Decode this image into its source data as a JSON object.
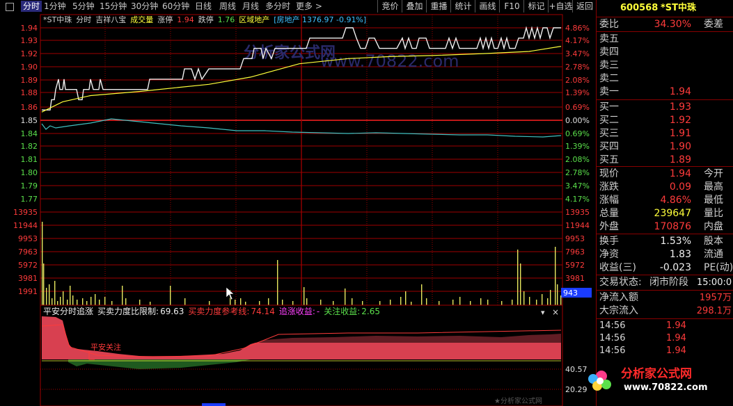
{
  "toolbar": {
    "tabs": [
      "分时",
      "1分钟",
      "5分钟",
      "15分钟",
      "30分钟",
      "60分钟",
      "日线",
      "周线",
      "月线",
      "多分时",
      "更多 >"
    ],
    "buttons": [
      "竞价",
      "叠加",
      "重播",
      "统计",
      "画线",
      "F10",
      "标记",
      "+自选",
      "返回"
    ]
  },
  "header": {
    "code": "*ST中珠",
    "mode": "分时",
    "indicator": "吉祥八宝",
    "vol_label": "成交量",
    "up_stop_label": "涨停",
    "up_stop": "1.94",
    "down_stop_label": "跌停",
    "down_stop": "1.76",
    "sector_label": "区域地产",
    "sector_detail": "[房地产 1376.97 -0.91%]"
  },
  "price_axis": [
    "1.94",
    "1.93",
    "1.92",
    "1.90",
    "1.89",
    "1.88",
    "1.86",
    "1.85",
    "1.84",
    "1.82",
    "1.81",
    "1.80",
    "1.79",
    "1.77"
  ],
  "pct_axis": [
    "4.86%",
    "4.17%",
    "3.47%",
    "2.78%",
    "2.08%",
    "1.39%",
    "0.69%",
    "0.00%",
    "0.69%",
    "1.39%",
    "2.08%",
    "2.78%",
    "3.47%",
    "4.17%"
  ],
  "vol_axis": [
    "13935",
    "11944",
    "9953",
    "7963",
    "5972",
    "3981",
    "1991"
  ],
  "vol_badge": "943",
  "indicator_bar": {
    "name": "平安分时追涨",
    "limit_label": "买卖力度比限制:",
    "limit_value": "69.63",
    "ref_label": "买卖力度参考线:",
    "ref_value": "74.14",
    "chase_label": "追涨收益:",
    "chase_value": "-",
    "focus_label": "关注收益:",
    "focus_value": "2.65",
    "signal_text": "平安关注",
    "axis": [
      "40.57",
      "20.29"
    ],
    "watermark": "★分析家公式网"
  },
  "chart_watermark": {
    "line1": "分析家公式网",
    "line2": "www.70822.com"
  },
  "panel": {
    "stock_code": "600568",
    "stock_name": "*ST中珠",
    "weibi_label": "委比",
    "weibi_value": "34.30%",
    "weicha_label": "委差",
    "sells": [
      {
        "label": "卖五",
        "price": ""
      },
      {
        "label": "卖四",
        "price": ""
      },
      {
        "label": "卖三",
        "price": ""
      },
      {
        "label": "卖二",
        "price": ""
      },
      {
        "label": "卖一",
        "price": "1.94"
      }
    ],
    "buys": [
      {
        "label": "买一",
        "price": "1.93"
      },
      {
        "label": "买二",
        "price": "1.92"
      },
      {
        "label": "买三",
        "price": "1.91"
      },
      {
        "label": "买四",
        "price": "1.90"
      },
      {
        "label": "买五",
        "price": "1.89"
      }
    ],
    "quotes": [
      {
        "k": "现价",
        "v": "1.94",
        "k2": "今开",
        "c": "red"
      },
      {
        "k": "涨跌",
        "v": "0.09",
        "k2": "最高",
        "c": "red"
      },
      {
        "k": "涨幅",
        "v": "4.86%",
        "k2": "最低",
        "c": "red"
      },
      {
        "k": "总量",
        "v": "239647",
        "k2": "量比",
        "c": "yel"
      },
      {
        "k": "外盘",
        "v": "170876",
        "k2": "内盘",
        "c": "red"
      }
    ],
    "stats": [
      {
        "k": "换手",
        "v": "1.53%",
        "k2": "股本"
      },
      {
        "k": "净资",
        "v": "1.83",
        "k2": "流通"
      },
      {
        "k": "收益(三)",
        "v": "-0.023",
        "k2": "PE(动)"
      }
    ],
    "trade_status_label": "交易状态:",
    "trade_status": "闭市阶段",
    "trade_time": "15:00:0",
    "flow": [
      {
        "k": "净流入额",
        "v": "1957万"
      },
      {
        "k": "大宗流入",
        "v": "298.1万"
      }
    ],
    "ticks": [
      {
        "t": "14:56",
        "p": "1.94"
      },
      {
        "t": "14:56",
        "p": "1.94"
      },
      {
        "t": "14:56",
        "p": "1.94"
      }
    ]
  },
  "logo": {
    "name": "分析家公式网",
    "url": "www.70822.com"
  }
}
